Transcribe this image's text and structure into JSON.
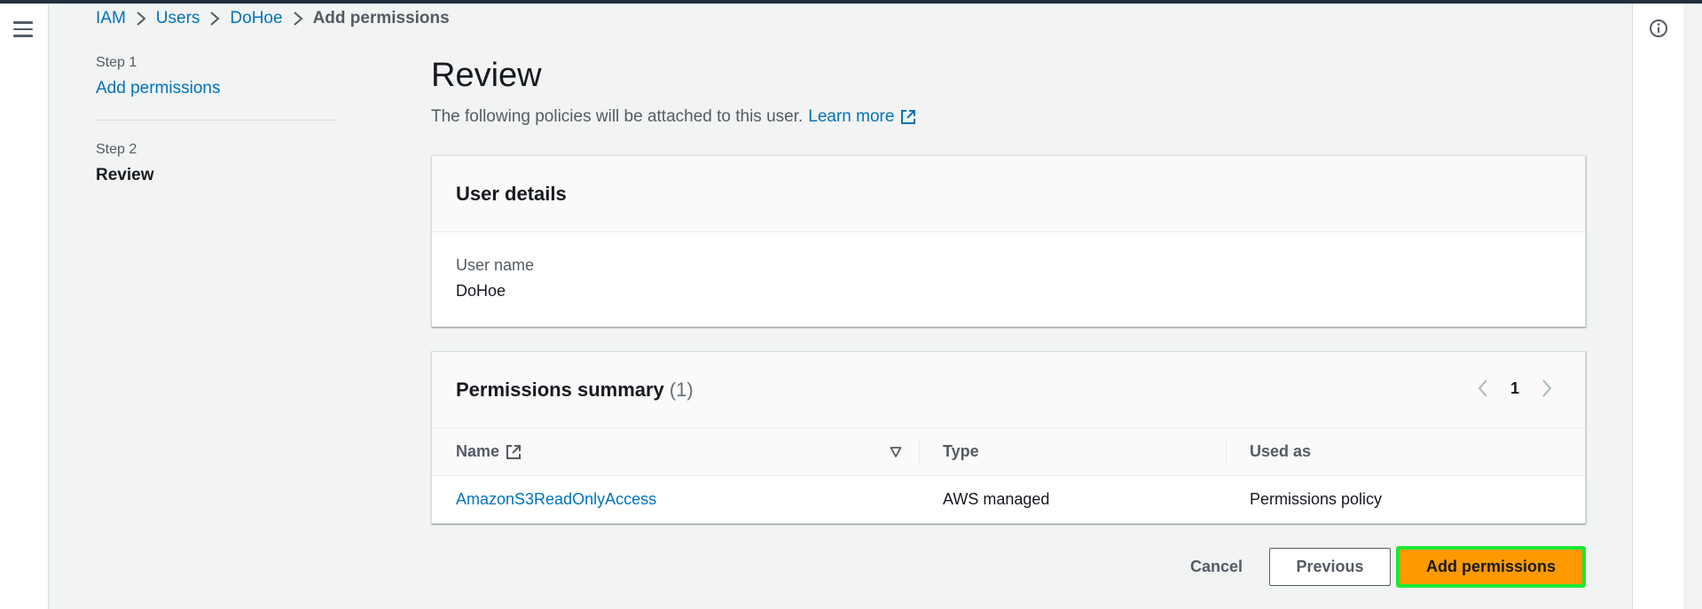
{
  "breadcrumb": {
    "items": [
      "IAM",
      "Users",
      "DoHoe"
    ],
    "current": "Add permissions"
  },
  "steps": {
    "step1_label": "Step 1",
    "step1_title": "Add permissions",
    "step2_label": "Step 2",
    "step2_title": "Review"
  },
  "page": {
    "title": "Review",
    "description": "The following policies will be attached to this user.",
    "learn_more": "Learn more"
  },
  "user_details": {
    "title": "User details",
    "username_label": "User name",
    "username_value": "DoHoe"
  },
  "permissions": {
    "title": "Permissions summary",
    "count": "(1)",
    "page": "1",
    "columns": [
      "Name",
      "Type",
      "Used as"
    ],
    "rows": [
      {
        "name": "AmazonS3ReadOnlyAccess",
        "type": "AWS managed",
        "used_as": "Permissions policy"
      }
    ]
  },
  "actions": {
    "cancel": "Cancel",
    "previous": "Previous",
    "submit": "Add permissions"
  },
  "colors": {
    "link": "#0073bb",
    "primary": "#ff9900",
    "highlight": "#1ee832"
  },
  "icons": [
    "menu-icon",
    "info-icon",
    "chevron-right-icon",
    "external-link-icon",
    "sort-down-icon",
    "chevron-left-icon"
  ]
}
